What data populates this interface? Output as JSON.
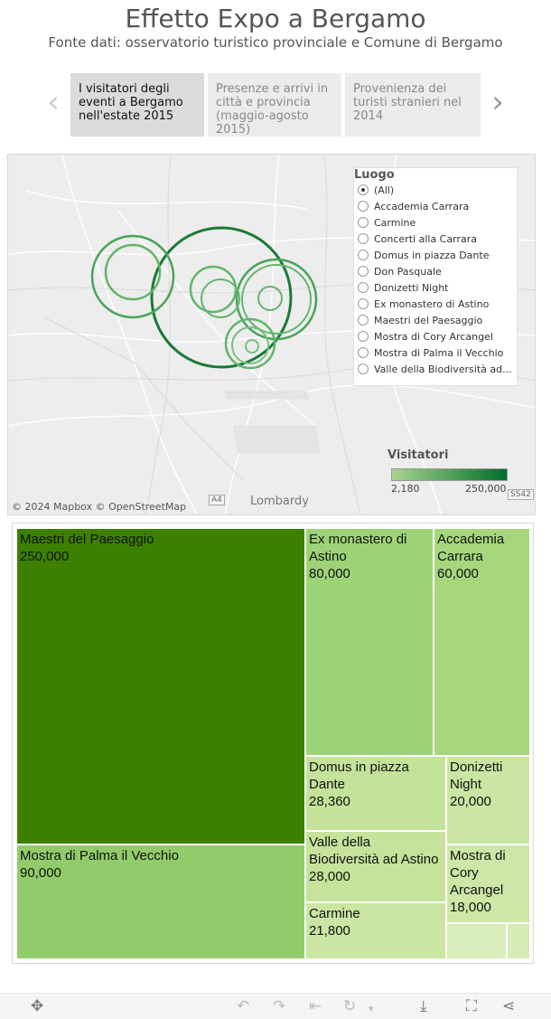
{
  "header": {
    "title": "Effetto Expo a Bergamo",
    "subtitle": "Fonte dati: osservatorio turistico provinciale e Comune di Bergamo"
  },
  "story": {
    "prev_icon": "chevron-left-icon",
    "next_icon": "chevron-right-icon",
    "points": [
      {
        "label": "I visitatori degli eventi a Bergamo nell'estate 2015",
        "active": true
      },
      {
        "label": "Presenze e arrivi in città e provincia (maggio-agosto 2015)",
        "active": false
      },
      {
        "label": "Provenienza dei turisti stranieri nel 2014",
        "active": false
      }
    ]
  },
  "map": {
    "attribution": "© 2024 Mapbox  © OpenStreetMap",
    "place_label": "Lombardy",
    "road_labels": [
      "A4",
      "SS42"
    ],
    "filter": {
      "title": "Luogo",
      "selected": "(All)",
      "options": [
        "(All)",
        "Accademia Carrara",
        "Carmine",
        "Concerti alla Carrara",
        "Domus in piazza Dante",
        "Don Pasquale",
        "Donizetti Night",
        "Ex monastero di Astino",
        "Maestri del Paesaggio",
        "Mostra di Cory Arcangel",
        "Mostra di Palma il Vecchio",
        "Valle della Biodiversità ad..."
      ]
    },
    "color_legend": {
      "title": "Visitatori",
      "min_label": "2,180",
      "max_label": "250,000",
      "min_color": "#a8d58e",
      "max_color": "#006d2c"
    }
  },
  "chart_data": {
    "type": "treemap",
    "value_label": "Visitatori",
    "items": [
      {
        "name": "Maestri del Paesaggio",
        "value": 250000,
        "label": "250,000",
        "color": "#3d8000"
      },
      {
        "name": "Mostra di Palma il Vecchio",
        "value": 90000,
        "label": "90,000",
        "color": "#92cc6a"
      },
      {
        "name": "Ex monastero di Astino",
        "value": 80000,
        "label": "80,000",
        "color": "#9dd377"
      },
      {
        "name": "Accademia Carrara",
        "value": 60000,
        "label": "60,000",
        "color": "#a6d77d"
      },
      {
        "name": "Domus in piazza Dante",
        "value": 28360,
        "label": "28,360",
        "color": "#c4e39a"
      },
      {
        "name": "Valle della Biodiversità ad Astino",
        "value": 28000,
        "label": "28,000",
        "color": "#c5e39b"
      },
      {
        "name": "Carmine",
        "value": 21800,
        "label": "21,800",
        "color": "#cae6a3"
      },
      {
        "name": "Donizetti Night",
        "value": 20000,
        "label": "20,000",
        "color": "#cbe6a4"
      },
      {
        "name": "Mostra di Cory Arcangel",
        "value": 18000,
        "label": "18,000",
        "color": "#cde7a7"
      },
      {
        "name": "",
        "value": null,
        "label": "",
        "color": "#d8edba"
      },
      {
        "name": "",
        "value": null,
        "label": "",
        "color": "#d6ebb6"
      }
    ]
  },
  "toolbar": {
    "icons": [
      "pan-icon",
      "undo-icon",
      "redo-icon",
      "revert-icon",
      "refresh-icon",
      "dropdown-icon",
      "download-icon",
      "fullscreen-icon",
      "share-icon"
    ]
  }
}
